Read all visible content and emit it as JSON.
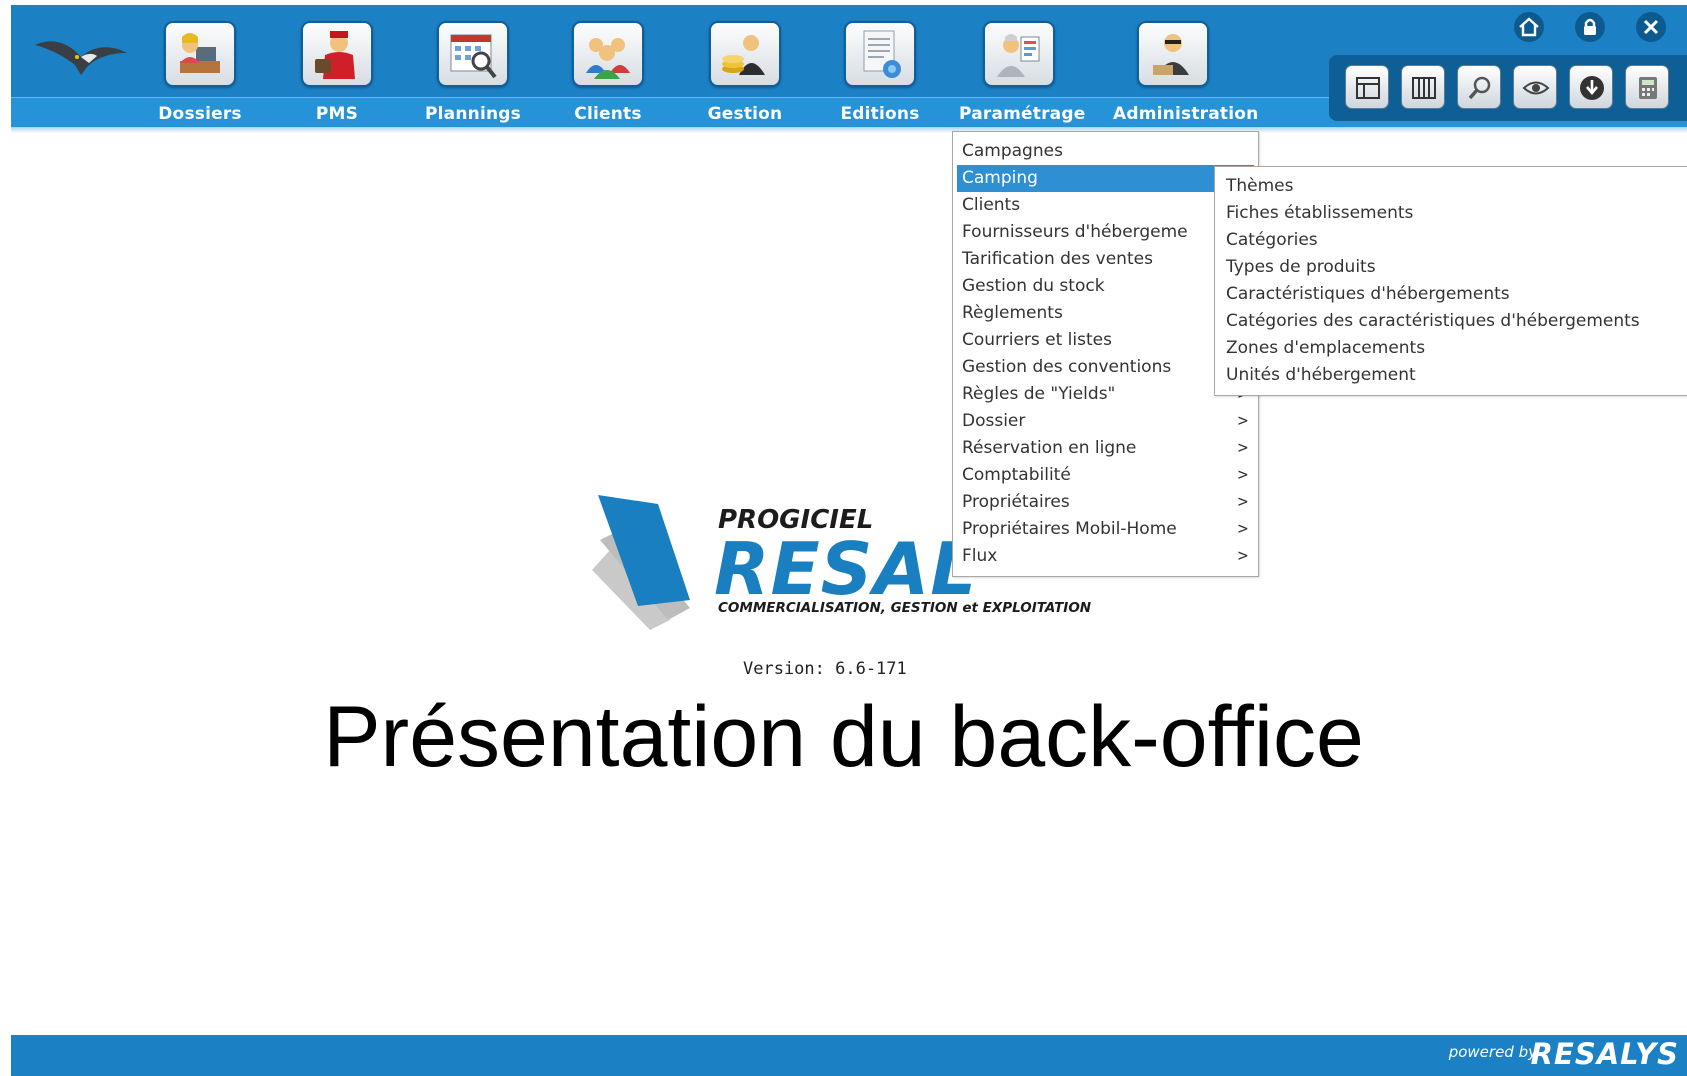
{
  "nav": [
    {
      "label": "Dossiers",
      "icon": "user-at-desk-icon"
    },
    {
      "label": "PMS",
      "icon": "bellboy-icon"
    },
    {
      "label": "Plannings",
      "icon": "calendar-magnifier-icon"
    },
    {
      "label": "Clients",
      "icon": "people-group-icon"
    },
    {
      "label": "Gestion",
      "icon": "businessman-coins-icon"
    },
    {
      "label": "Editions",
      "icon": "document-print-icon"
    },
    {
      "label": "Paramétrage",
      "icon": "settings-person-icon"
    },
    {
      "label": "Administration",
      "icon": "admin-person-icon"
    }
  ],
  "top_icons": [
    "home-icon",
    "lock-icon",
    "close-icon"
  ],
  "tools": [
    "table-edit-icon",
    "columns-icon",
    "magnifier-icon",
    "eye-icon",
    "download-icon",
    "calculator-icon"
  ],
  "menu": {
    "items": [
      {
        "label": "Campagnes",
        "arrow": ""
      },
      {
        "label": "Camping",
        "arrow": ""
      },
      {
        "label": "Clients",
        "arrow": ""
      },
      {
        "label": "Fournisseurs d'hébergeme",
        "arrow": ""
      },
      {
        "label": "Tarification des ventes",
        "arrow": ""
      },
      {
        "label": "Gestion du stock",
        "arrow": ""
      },
      {
        "label": "Règlements",
        "arrow": ""
      },
      {
        "label": "Courriers et listes",
        "arrow": ""
      },
      {
        "label": "Gestion des conventions",
        "arrow": ""
      },
      {
        "label": "Règles de \"Yields\"",
        "arrow": ">"
      },
      {
        "label": "Dossier",
        "arrow": ">"
      },
      {
        "label": "Réservation en ligne",
        "arrow": ">"
      },
      {
        "label": "Comptabilité",
        "arrow": ">"
      },
      {
        "label": "Propriétaires",
        "arrow": ">"
      },
      {
        "label": "Propriétaires Mobil-Home",
        "arrow": ">"
      },
      {
        "label": "Flux",
        "arrow": ">"
      }
    ],
    "active_index": 1
  },
  "submenu": {
    "items": [
      "Thèmes",
      "Fiches établissements",
      "Catégories",
      "Types de produits",
      "Caractéristiques d'hébergements",
      "Catégories des caractéristiques d'hébergements",
      "Zones d'emplacements",
      "Unités d'hébergement"
    ]
  },
  "logo": {
    "progiciel": "PROGICIEL",
    "brand": "RESAL",
    "tagline": "COMMERCIALISATION, GESTION et EXPLOITATION"
  },
  "version": "Version: 6.6-171",
  "title": "Présentation du back-office",
  "footer": {
    "powered_by": "powered by",
    "brand": "RESALYS"
  },
  "colors": {
    "primary": "#1b80c4",
    "label_band": "#2693d8",
    "menu_active": "#2e8fd3",
    "brand_blue": "#1a7fc0"
  }
}
